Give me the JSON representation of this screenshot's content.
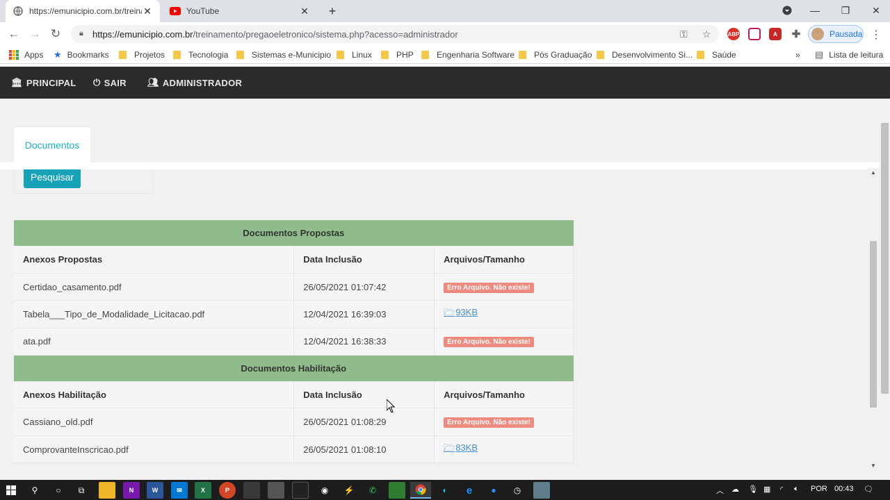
{
  "browser": {
    "tabs": [
      {
        "title": "https://emunicipio.com.br/treina",
        "active": true
      },
      {
        "title": "YouTube",
        "active": false
      }
    ],
    "url_host": "https://emunicipio.com.br",
    "url_path": "/treinamento/pregaoeletronico/sistema.php?acesso=administrador",
    "profile_label": "Pausada",
    "ext_abp": "ABP",
    "bookmarks": [
      {
        "label": "Apps",
        "icon": "apps-grid-icon"
      },
      {
        "label": "Bookmarks",
        "icon": "star-icon"
      },
      {
        "label": "Projetos",
        "icon": "folder-icon"
      },
      {
        "label": "Tecnologia",
        "icon": "folder-icon"
      },
      {
        "label": "Sistemas e-Municipio",
        "icon": "folder-icon"
      },
      {
        "label": "Linux",
        "icon": "folder-icon"
      },
      {
        "label": "PHP",
        "icon": "folder-icon"
      },
      {
        "label": "Engenharia Software",
        "icon": "folder-icon"
      },
      {
        "label": "Pós Graduação",
        "icon": "folder-icon"
      },
      {
        "label": "Desenvolvimento Si...",
        "icon": "folder-icon"
      },
      {
        "label": "Saúde",
        "icon": "folder-icon"
      }
    ],
    "more_bookmarks": "»",
    "reading_list": "Lista de leitura"
  },
  "app": {
    "nav": [
      {
        "label": "PRINCIPAL",
        "icon": "bank-icon"
      },
      {
        "label": "SAIR",
        "icon": "power-icon"
      },
      {
        "label": "ADMINISTRADOR",
        "icon": "users-icon"
      }
    ],
    "tab_label": "Documentos",
    "search_button": "Pesquisar",
    "sections": [
      {
        "title": "Documentos Propostas",
        "headers": [
          "Anexos Propostas",
          "Data Inclusão",
          "Arquivos/Tamanho"
        ],
        "rows": [
          {
            "file": "Certidao_casamento.pdf",
            "date": "26/05/2021 01:07:42",
            "status": "error",
            "value": "Erro Arquivo. Não existe!"
          },
          {
            "file": "Tabela___Tipo_de_Modalidade_Licitacao.pdf",
            "date": "12/04/2021 16:39:03",
            "status": "link",
            "value": "93KB"
          },
          {
            "file": "ata.pdf",
            "date": "12/04/2021 16:38:33",
            "status": "error",
            "value": "Erro Arquivo. Não existe!"
          }
        ]
      },
      {
        "title": "Documentos Habilitação",
        "headers": [
          "Anexos Habilitação",
          "Data Inclusão",
          "Arquivos/Tamanho"
        ],
        "rows": [
          {
            "file": "Cassiano_old.pdf",
            "date": "26/05/2021 01:08:29",
            "status": "error",
            "value": "Erro Arquivo. Não existe!"
          },
          {
            "file": "ComprovanteInscricao.pdf",
            "date": "26/05/2021 01:08:10",
            "status": "link",
            "value": "83KB"
          }
        ]
      }
    ]
  },
  "taskbar": {
    "language": "POR",
    "time": "00:43"
  },
  "colors": {
    "section_header": "#8fbc8a",
    "nav_bg": "#2b2b2b",
    "accent": "#17a2b8",
    "error_badge": "#ef8a7f",
    "link": "#4a8fc7"
  }
}
